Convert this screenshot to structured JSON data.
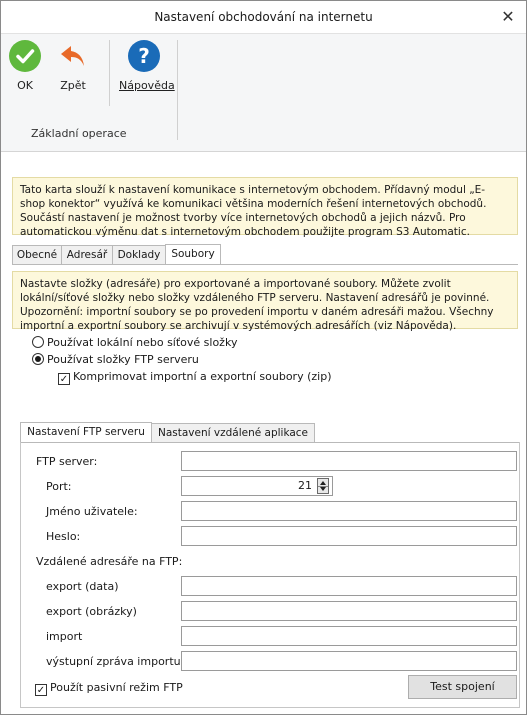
{
  "window": {
    "title": "Nastavení obchodování na internetu",
    "close_glyph": "✕"
  },
  "ribbon": {
    "buttons": [
      {
        "label": "OK",
        "icon": "check-icon",
        "color": "#5fb83d"
      },
      {
        "label": "Zpět",
        "icon": "undo-arrow-icon",
        "color": "#e86a2a"
      },
      {
        "label": "Nápověda",
        "icon": "help-icon",
        "color": "#1a6bb8"
      }
    ],
    "group_title": "Základní operace"
  },
  "info_text": "Tato karta slouží k nastavení komunikace s internetovým obchodem. Přídavný modul „E-shop konektor“ využívá ke komunikaci většina moderních řešení internetových obchodů. Součástí nastavení je možnost tvorby více internetových obchodů a jejich názvů. Pro automatickou výměnu dat s internetovým obchodem použijte program S3 Automatic.",
  "main_tabs": [
    "Obecné",
    "Adresář",
    "Doklady",
    "Soubory"
  ],
  "files": {
    "info_text": "Nastavte složky (adresáře) pro exportované a importované soubory. Můžete zvolit lokální/síťové složky nebo složky vzdáleného FTP serveru. Nastavení adresářů je povinné. Upozornění: importní soubory se po provedení importu v daném adresáři mažou. Všechny importní a exportní soubory se archivují v systémových adresářích (viz Nápověda).",
    "radio_local": "Používat lokální nebo síťové složky",
    "radio_ftp": "Používat složky FTP serveru",
    "compress_label": "Komprimovat importní a exportní soubory (zip)",
    "compress_checked": "✓"
  },
  "sub_tabs": [
    "Nastavení FTP serveru",
    "Nastavení vzdálené aplikace"
  ],
  "ftp": {
    "server_label": "FTP server:",
    "server_value": "",
    "port_label": "Port:",
    "port_value": "21",
    "user_label": "Jméno uživatele:",
    "user_value": "",
    "password_label": "Heslo:",
    "password_value": "",
    "remote_dirs_label": "Vzdálené adresáře na FTP:",
    "export_data_label": "export (data)",
    "export_images_label": "export (obrázky)",
    "import_label": "import",
    "import_report_label": "výstupní zpráva importu",
    "passive_label": "Použít pasivní režim FTP",
    "passive_checked": "✓",
    "test_button": "Test spojení"
  }
}
